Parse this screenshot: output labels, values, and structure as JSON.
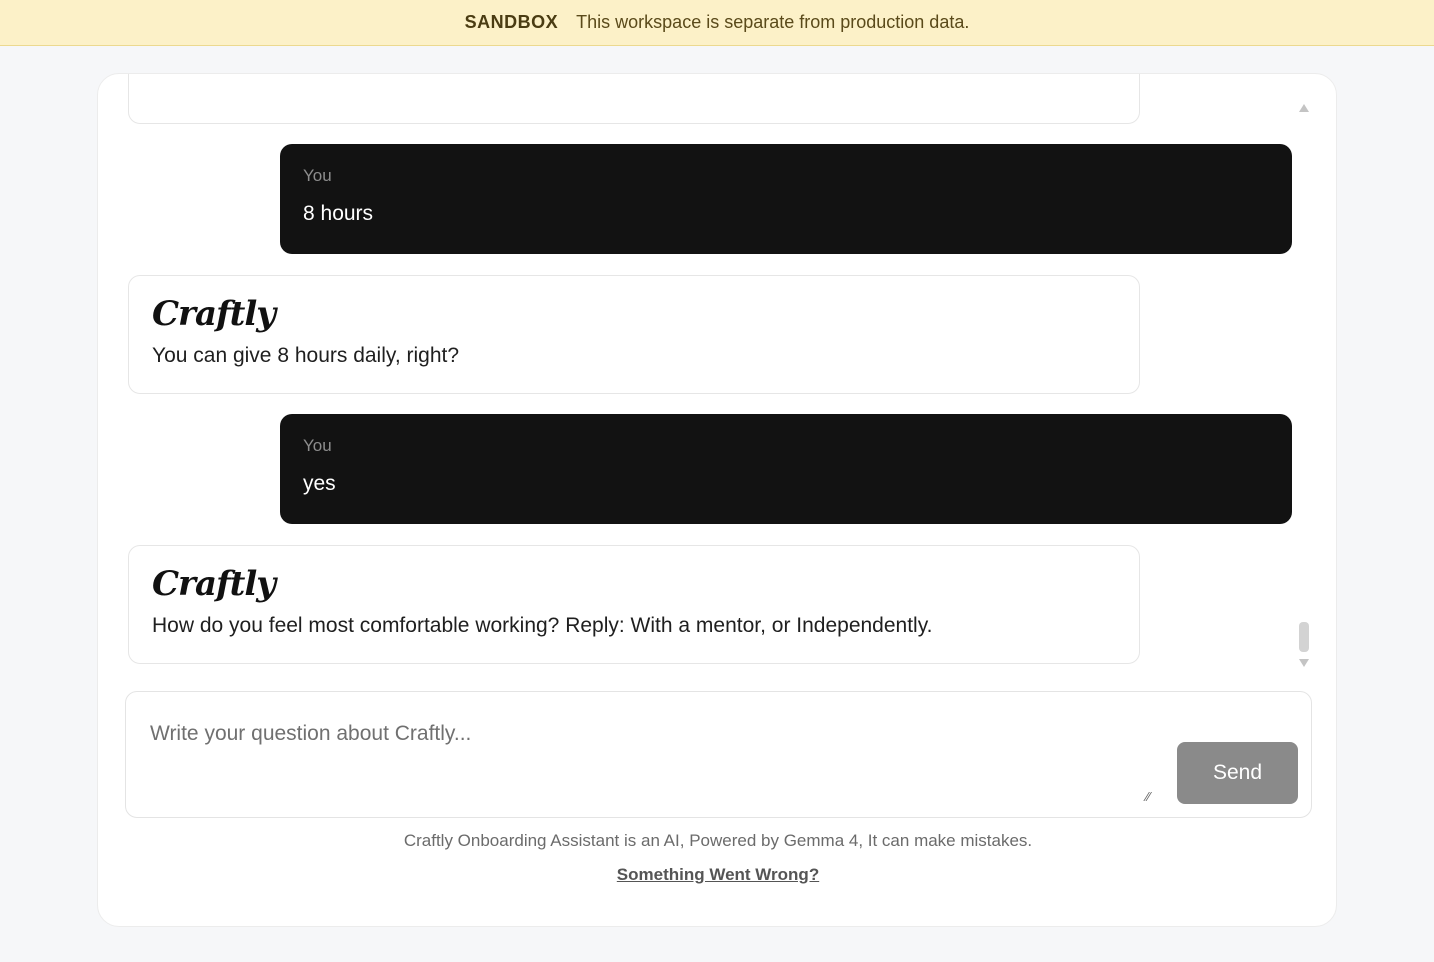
{
  "banner": {
    "tag": "SANDBOX",
    "message": "This workspace is separate from production data."
  },
  "chat": {
    "bot_name": "Craftly",
    "messages": [
      {
        "role": "user",
        "label": "You",
        "text": "8 hours"
      },
      {
        "role": "bot",
        "text": "You can give 8 hours daily, right?"
      },
      {
        "role": "user",
        "label": "You",
        "text": "yes"
      },
      {
        "role": "bot",
        "text": "How do you feel most comfortable working? Reply: With a mentor, or Independently."
      }
    ]
  },
  "composer": {
    "placeholder": "Write your question about Craftly...",
    "send_label": "Send"
  },
  "footer": {
    "disclaimer": "Craftly Onboarding Assistant is an AI, Powered by Gemma 4, It can make mistakes.",
    "help_link": "Something Went Wrong?"
  }
}
